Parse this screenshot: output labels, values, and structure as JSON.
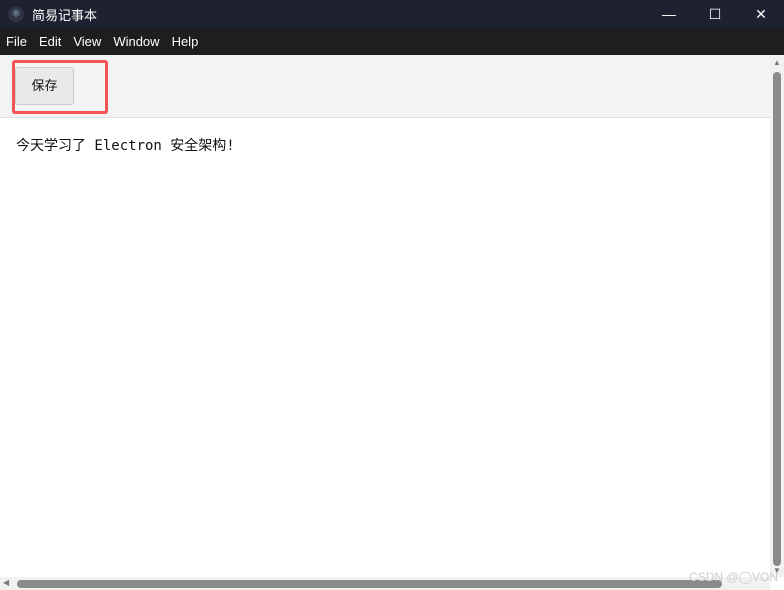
{
  "window": {
    "title": "简易记事本",
    "minimize": "—",
    "maximize": "☐",
    "close": "✕"
  },
  "menu": [
    "File",
    "Edit",
    "View",
    "Window",
    "Help"
  ],
  "toolbar": {
    "save_label": "保存"
  },
  "editor": {
    "content": "今天学习了 Electron 安全架构!"
  },
  "watermark": "CSDN @◯VON"
}
